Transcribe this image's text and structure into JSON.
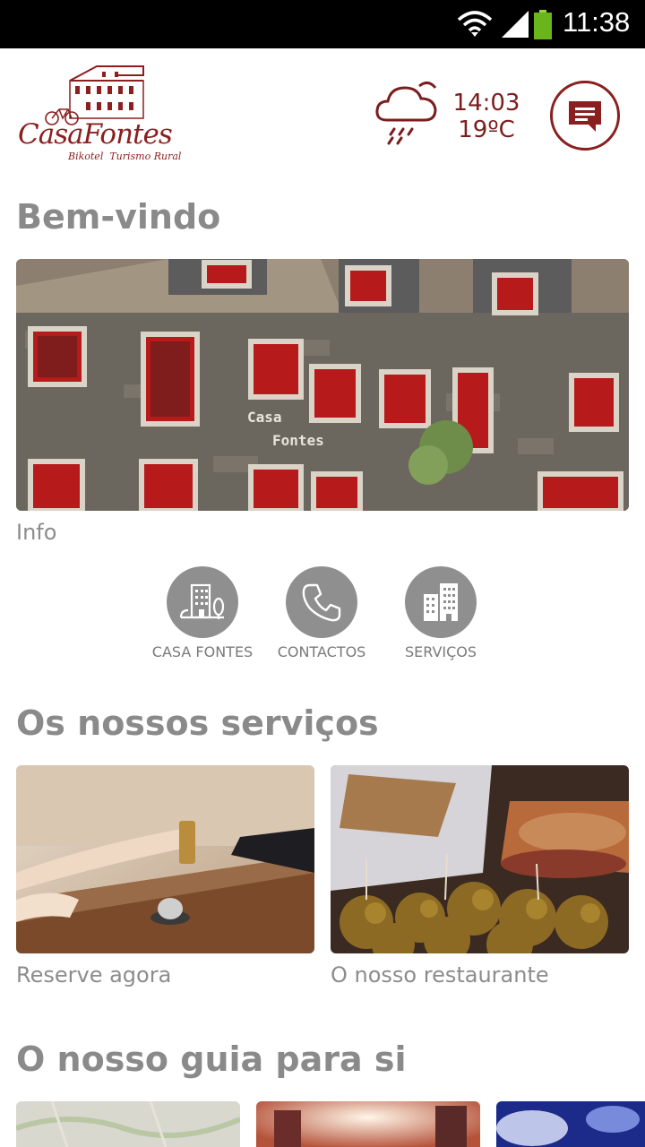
{
  "status_bar": {
    "time": "11:38",
    "icons": [
      "wifi-icon",
      "signal-icon",
      "battery-icon"
    ],
    "battery_color": "#69b51b"
  },
  "header": {
    "logo": {
      "name": "CasaFontes",
      "tagline": "Bikotel  Turismo Rural"
    },
    "weather": {
      "icon": "rain-cloud-icon",
      "time": "14:03",
      "temperature": "19ºC"
    },
    "chat_icon": "chat-icon",
    "accent_color": "#8b1f1f"
  },
  "welcome": {
    "title": "Bem-vindo",
    "image_caption": "Info"
  },
  "quick_links": [
    {
      "label": "CASA FONTES",
      "icon": "building-tree-icon"
    },
    {
      "label": "CONTACTOS",
      "icon": "phone-icon"
    },
    {
      "label": "SERVIÇOS",
      "icon": "buildings-icon"
    }
  ],
  "services": {
    "title": "Os nossos serviços",
    "cards": [
      {
        "caption": "Reserve agora"
      },
      {
        "caption": "O nosso restaurante"
      }
    ]
  },
  "guide": {
    "title": "O nosso guia para si"
  }
}
